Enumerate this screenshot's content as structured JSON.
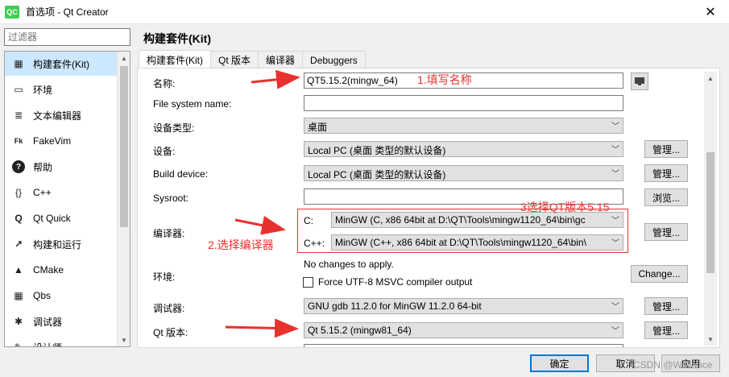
{
  "window": {
    "app_icon": "QC",
    "title": "首选项 - Qt Creator",
    "close_glyph": "✕"
  },
  "filter": {
    "placeholder": "过滤器"
  },
  "categories": [
    {
      "label": "构建套件(Kit)",
      "icon": "kit-icon",
      "glyph": "▦"
    },
    {
      "label": "环境",
      "icon": "monitor-icon",
      "glyph": "▭"
    },
    {
      "label": "文本编辑器",
      "icon": "text-editor-icon",
      "glyph": "≣"
    },
    {
      "label": "FakeVim",
      "icon": "fakevim-icon",
      "glyph": "Fk"
    },
    {
      "label": "帮助",
      "icon": "help-icon",
      "glyph": "?"
    },
    {
      "label": "C++",
      "icon": "braces-icon",
      "glyph": "{}"
    },
    {
      "label": "Qt Quick",
      "icon": "qt-quick-icon",
      "glyph": "Q"
    },
    {
      "label": "构建和运行",
      "icon": "hammer-icon",
      "glyph": "↗"
    },
    {
      "label": "CMake",
      "icon": "cmake-icon",
      "glyph": "▲"
    },
    {
      "label": "Qbs",
      "icon": "qbs-icon",
      "glyph": "▦"
    },
    {
      "label": "调试器",
      "icon": "bug-icon",
      "glyph": "✱"
    },
    {
      "label": "设计师",
      "icon": "designer-icon",
      "glyph": "✎"
    }
  ],
  "page_title": "构建套件(Kit)",
  "tabs": [
    "构建套件(Kit)",
    "Qt 版本",
    "编译器",
    "Debuggers"
  ],
  "form": {
    "name_label": "名称:",
    "name_value": "QT5.15.2(mingw_64)",
    "fs_label": "File system name:",
    "fs_value": "",
    "device_type_label": "设备类型:",
    "device_type_value": "桌面",
    "device_label": "设备:",
    "device_value": "Local PC (桌面 类型的默认设备)",
    "build_device_label": "Build device:",
    "build_device_value": "Local PC (桌面 类型的默认设备)",
    "sysroot_label": "Sysroot:",
    "sysroot_value": "",
    "compiler_label": "编译器:",
    "c_label": "C:",
    "c_value": "MinGW (C, x86 64bit at D:\\QT\\Tools\\mingw1120_64\\bin\\gc",
    "cpp_label": "C++:",
    "cpp_value": "MinGW (C++, x86 64bit at D:\\QT\\Tools\\mingw1120_64\\bin\\",
    "env_label": "环境:",
    "env_value": "No changes to apply.",
    "force_utf8_label": "Force UTF-8 MSVC compiler output",
    "debugger_label": "调试器:",
    "debugger_value": "GNU gdb 11.2.0 for MinGW 11.2.0 64-bit",
    "qt_version_label": "Qt 版本:",
    "qt_version_value": "Qt 5.15.2 (mingw81_64)",
    "manage_label": "管理...",
    "browse_label": "浏览...",
    "change_label": "Change..."
  },
  "annotations": {
    "step1": "1.填写名称",
    "step2": "2.选择编译器",
    "step3": "3选择QT版本5.15"
  },
  "buttons": {
    "ok": "确定",
    "cancel": "取消",
    "apply": "应用"
  },
  "watermark": "CSDN @Wallance",
  "colors": {
    "annotation": "#e8312f",
    "selection": "#cce8ff",
    "default_button_border": "#0078d7"
  }
}
